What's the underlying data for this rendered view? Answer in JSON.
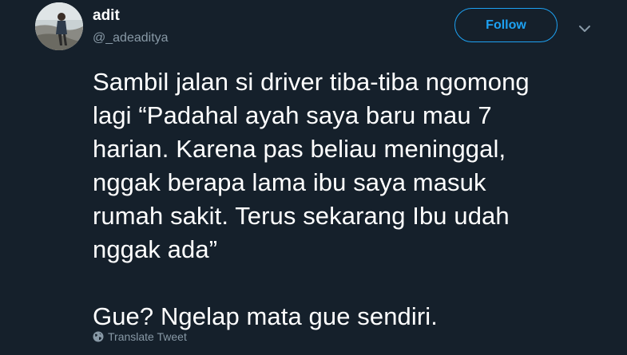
{
  "author": {
    "display_name": "adit",
    "handle": "@_adeaditya"
  },
  "header": {
    "follow_label": "Follow",
    "more_icon": "chevron-down-icon"
  },
  "tweet": {
    "text": "Sambil jalan si driver tiba-tiba ngomong\nlagi “Padahal ayah saya baru mau 7\nharian. Karena pas beliau meninggal,\nnggak berapa lama ibu saya masuk\nrumah sakit. Terus sekarang Ibu udah\nnggak ada”\n\nGue? Ngelap mata gue sendiri.",
    "translate_label": "Translate Tweet",
    "translate_icon": "globe-icon"
  },
  "colors": {
    "background": "#15202b",
    "accent": "#1da1f2",
    "secondary_text": "#8899a6",
    "primary_text": "#ffffff"
  }
}
